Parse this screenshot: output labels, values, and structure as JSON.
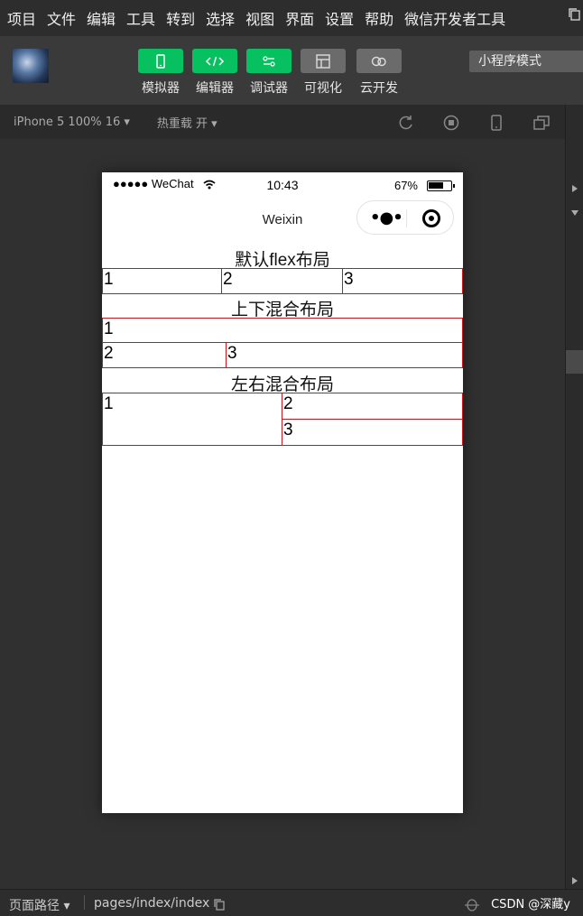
{
  "menu": [
    "项目",
    "文件",
    "编辑",
    "工具",
    "转到",
    "选择",
    "视图",
    "界面",
    "设置",
    "帮助",
    "微信开发者工具"
  ],
  "toolbar": {
    "buttons": [
      {
        "label": "模拟器",
        "icon": "phone-icon",
        "style": "green"
      },
      {
        "label": "编辑器",
        "icon": "code-icon",
        "style": "green"
      },
      {
        "label": "调试器",
        "icon": "toggle-icon",
        "style": "green"
      },
      {
        "label": "可视化",
        "icon": "layout-icon",
        "style": "gray"
      },
      {
        "label": "云开发",
        "icon": "cloud-icon",
        "style": "gray"
      }
    ],
    "mode": "小程序模式"
  },
  "simbar": {
    "device": "iPhone 5 100% 16 ▾",
    "hotreload": "热重载 开 ▾",
    "icons": [
      "refresh-icon",
      "stop-icon",
      "device-icon",
      "window-icon"
    ]
  },
  "phone": {
    "signal": "●●●●● WeChat",
    "time": "10:43",
    "battery": "67%",
    "nav_title": "Weixin",
    "sections": [
      {
        "title": "默认flex布局",
        "cells": [
          "1",
          "2",
          "3"
        ]
      },
      {
        "title": "上下混合布局",
        "cells": [
          "1",
          "2",
          "3"
        ]
      },
      {
        "title": "左右混合布局",
        "cells": [
          "1",
          "2",
          "3"
        ]
      }
    ]
  },
  "bottom": {
    "path_label": "页面路径 ▾",
    "page_path": "pages/index/index",
    "watermark": "CSDN @深藏y"
  },
  "colors": {
    "accent_green": "#07c160",
    "cell_border": "#c8161d"
  }
}
